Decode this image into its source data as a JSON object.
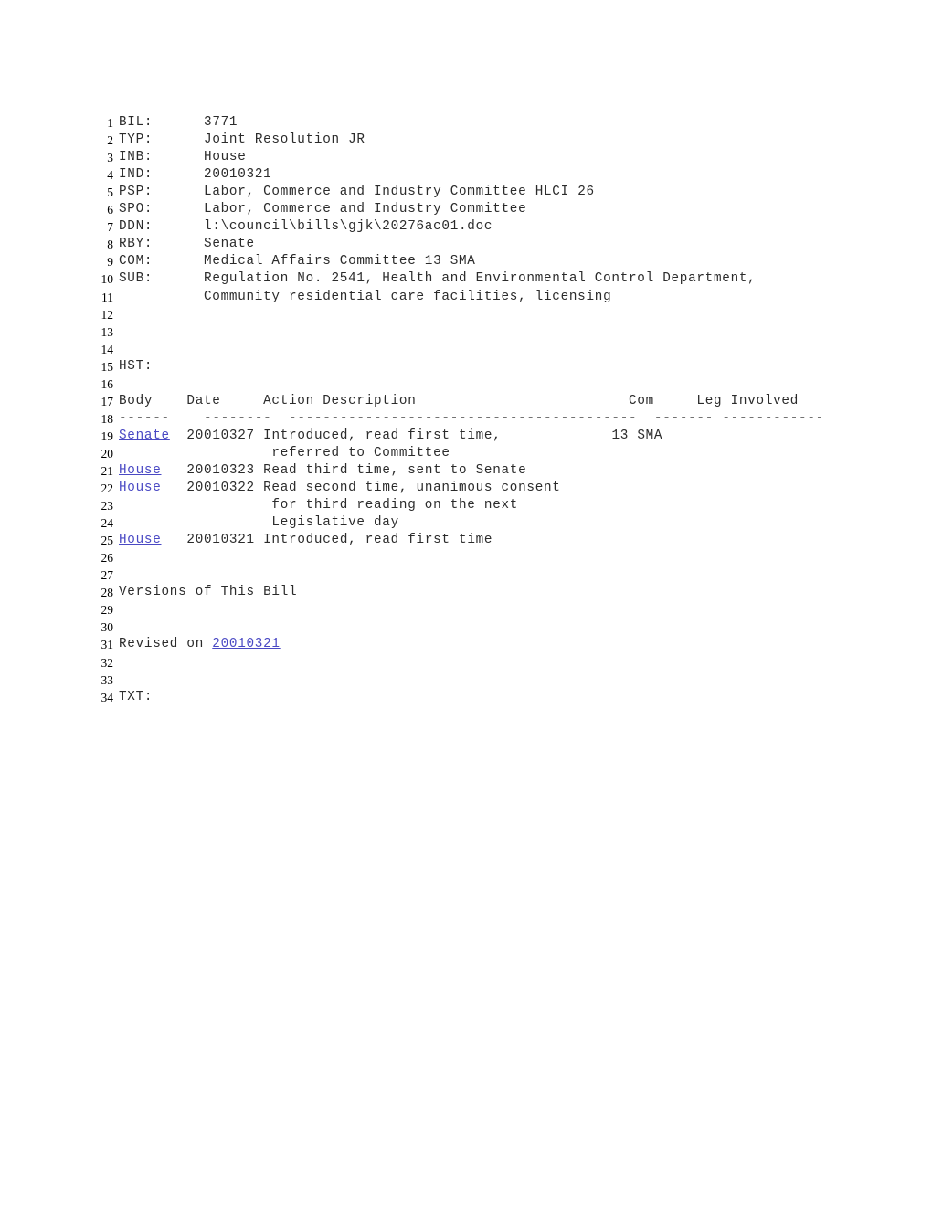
{
  "document": {
    "type": "legislative-bill-status-record",
    "colors": {
      "text": "#2b2b2b",
      "link": "#4a49c4",
      "line_number": "#000000",
      "background": "#ffffff"
    },
    "fields": [
      {
        "num": "1",
        "label": "BIL:",
        "value": "3771"
      },
      {
        "num": "2",
        "label": "TYP:",
        "value": "Joint Resolution JR"
      },
      {
        "num": "3",
        "label": "INB:",
        "value": "House"
      },
      {
        "num": "4",
        "label": "IND:",
        "value": "20010321"
      },
      {
        "num": "5",
        "label": "PSP:",
        "value": "Labor, Commerce and Industry Committee HLCI 26"
      },
      {
        "num": "6",
        "label": "SPO:",
        "value": "Labor, Commerce and Industry Committee"
      },
      {
        "num": "7",
        "label": "DDN:",
        "value": "l:\\council\\bills\\gjk\\20276ac01.doc"
      },
      {
        "num": "8",
        "label": "RBY:",
        "value": "Senate"
      },
      {
        "num": "9",
        "label": "COM:",
        "value": "Medical Affairs Committee 13 SMA"
      },
      {
        "num": "10",
        "label": "SUB:",
        "value": "Regulation No. 2541, Health and Environmental Control Department,"
      },
      {
        "num": "11",
        "label": "",
        "value": "Community residential care facilities, licensing"
      }
    ],
    "blank_lines_a": [
      "12",
      "13",
      "14"
    ],
    "hst": {
      "num": "15",
      "label": "HST:"
    },
    "blank_line_16": "16",
    "history_header": {
      "num": "17",
      "columns": [
        "Body",
        "Date",
        "Action Description",
        "Com",
        "Leg Involved"
      ]
    },
    "history_rule": {
      "num": "18",
      "dashes": [
        "------",
        "--------",
        "-----------------------------------------",
        "-------",
        "------------"
      ]
    },
    "history_rows": [
      {
        "num": "19",
        "body": "Senate",
        "body_is_link": true,
        "date": "20010327",
        "action": "Introduced, read first time,",
        "com": "13 SMA",
        "leg": ""
      },
      {
        "num": "20",
        "body": "",
        "body_is_link": false,
        "date": "",
        "action": "referred to Committee",
        "com": "",
        "leg": ""
      },
      {
        "num": "21",
        "body": "House",
        "body_is_link": true,
        "date": "20010323",
        "action": "Read third time, sent to Senate",
        "com": "",
        "leg": ""
      },
      {
        "num": "22",
        "body": "House",
        "body_is_link": true,
        "date": "20010322",
        "action": "Read second time, unanimous consent",
        "com": "",
        "leg": ""
      },
      {
        "num": "23",
        "body": "",
        "body_is_link": false,
        "date": "",
        "action": "for third reading on the next",
        "com": "",
        "leg": ""
      },
      {
        "num": "24",
        "body": "",
        "body_is_link": false,
        "date": "",
        "action": "Legislative day",
        "com": "",
        "leg": ""
      },
      {
        "num": "25",
        "body": "House",
        "body_is_link": true,
        "date": "20010321",
        "action": "Introduced, read first time",
        "com": "",
        "leg": ""
      }
    ],
    "blank_lines_b": [
      "26",
      "27"
    ],
    "versions_heading": {
      "num": "28",
      "text": "Versions of This Bill"
    },
    "blank_lines_c": [
      "29",
      "30"
    ],
    "revised": {
      "num": "31",
      "prefix": "Revised on ",
      "date_link": "20010321"
    },
    "blank_lines_d": [
      "32",
      "33"
    ],
    "txt": {
      "num": "34",
      "label": "TXT:"
    }
  }
}
